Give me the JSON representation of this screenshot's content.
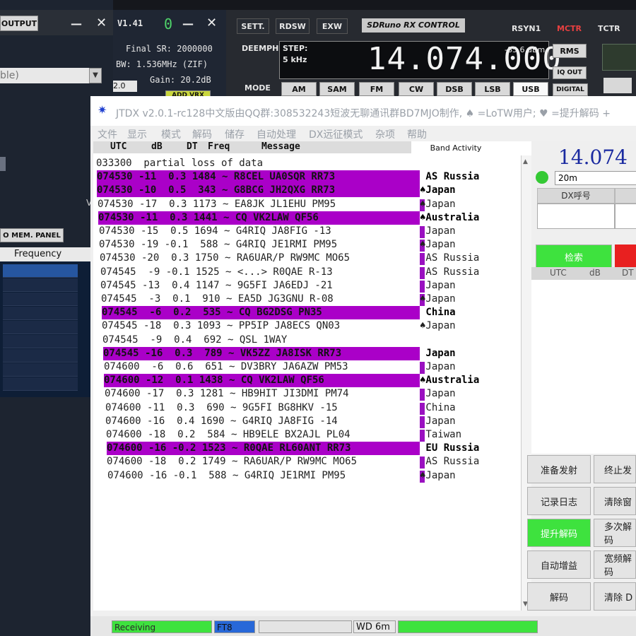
{
  "sdr_left": {
    "output_btn": "OUTPUT",
    "dropdown_value": "ble)",
    "mem_panel_btn": "O MEM. PANEL",
    "frequency_header": "Frequency",
    "stray_v": "V"
  },
  "sdr_mid": {
    "version": "V1.41",
    "digit": "0",
    "final_sr": "Final SR: 2000000",
    "bw": "BW: 1.536MHz (ZIF)",
    "gain": "Gain: 20.2dB",
    "zoom": "2.0",
    "add_vrx": "ADD VRX"
  },
  "rx_control": {
    "sett": "SETT.",
    "rdsw": "RDSW",
    "exw": "EXW",
    "title": "SDRuno RX CONTROL",
    "rsyn1": "RSYN1",
    "mctr": "MCTR",
    "tctr": "TCTR",
    "deemph": "DEEMPH",
    "step_label": "STEP:",
    "step_value": "5 kHz",
    "frequency": "14.074.000",
    "signal_dbm": "-85.6 dBm",
    "rms": "RMS",
    "iq_out": "IQ OUT",
    "digital": "DIGITAL",
    "mode_label": "MODE",
    "modes": [
      "AM",
      "SAM",
      "FM",
      "CW",
      "DSB",
      "LSB",
      "USB"
    ]
  },
  "jtdx": {
    "title": "JTDX   v2.0.1-rc128中文版由QQ群:308532243短波无聊通讯群BD7MJO制作, ♠ =LoTW用户; ♥ =提升解码 +",
    "menu": [
      "文件",
      "显示",
      "模式",
      "解码",
      "储存",
      "自动处理",
      "DX远征模式",
      "杂项",
      "帮助"
    ],
    "header": {
      "utc": "UTC",
      "db": "dB",
      "dt": "DT",
      "freq": "Freq",
      "message": "Message",
      "band_activity": "Band Activity"
    },
    "rows": [
      {
        "text": "033300  partial loss of data",
        "act": "",
        "hl": false
      },
      {
        "text": "074530 -11  0.3 1484 ~ R8CEL UA0SQR RR73",
        "act": " AS Russia",
        "hl": true
      },
      {
        "text": "074530 -10  0.5  343 ~ G8BCG JH2QXG RR73",
        "act": "♠Japan",
        "hl": true
      },
      {
        "text": "074530 -17  0.3 1173 ~ EA8JK JL1EHU PM95",
        "act": "♠Japan",
        "hl": false,
        "mk": true
      },
      {
        "text": "074530 -11  0.3 1441 ~ CQ VK2LAW QF56",
        "act": "♠Australia",
        "hl": true
      },
      {
        "text": "074530 -15  0.5 1694 ~ G4RIQ JA8FIG -13",
        "act": " Japan",
        "hl": false,
        "mk": true
      },
      {
        "text": "074530 -19 -0.1  588 ~ G4RIQ JE1RMI PM95",
        "act": "♠Japan",
        "hl": false,
        "mk": true
      },
      {
        "text": "074530 -20  0.3 1750 ~ RA6UAR/P RW9MC MO65",
        "act": " AS Russia",
        "hl": false,
        "mk": true
      },
      {
        "text": "074545  -9 -0.1 1525 ~ <...> R0QAE R-13",
        "act": " AS Russia",
        "hl": false,
        "mk": true
      },
      {
        "text": "074545 -13  0.4 1147 ~ 9G5FI JA6EDJ -21",
        "act": " Japan",
        "hl": false,
        "mk": true
      },
      {
        "text": "074545  -3  0.1  910 ~ EA5D JG3GNU R-08",
        "act": "♠Japan",
        "hl": false,
        "mk": true
      },
      {
        "text": "074545  -6  0.2  535 ~ CQ BG2DSG PN35",
        "act": " China",
        "hl": true
      },
      {
        "text": "074545 -18  0.3 1093 ~ PP5IP JA8ECS QN03",
        "act": "♠Japan",
        "hl": false
      },
      {
        "text": "074545  -9  0.4  692 ~ QSL 1WAY",
        "act": "",
        "hl": false
      },
      {
        "text": "074545 -16  0.3  789 ~ VK5ZZ JA8ISK RR73",
        "act": " Japan",
        "hl": true
      },
      {
        "text": "074600  -6  0.6  651 ~ DV3BRY JA6AZW PM53",
        "act": " Japan",
        "hl": false,
        "mk": true
      },
      {
        "text": "074600 -12  0.1 1438 ~ CQ VK2LAW QF56",
        "act": "♠Australia",
        "hl": true
      },
      {
        "text": "074600 -17  0.3 1281 ~ HB9HIT JI3DMI PM74",
        "act": " Japan",
        "hl": false,
        "mk": true
      },
      {
        "text": "074600 -11  0.3  690 ~ 9G5FI BG8HKV -15",
        "act": " China",
        "hl": false,
        "mk": true
      },
      {
        "text": "074600 -16  0.4 1690 ~ G4RIQ JA8FIG -14",
        "act": " Japan",
        "hl": false,
        "mk": true
      },
      {
        "text": "074600 -18  0.2  584 ~ HB9ELE BX2AJL PL04",
        "act": " Taiwan",
        "hl": false,
        "mk": true
      },
      {
        "text": "074600 -16 -0.2 1523 ~ R0QAE RL60ANT RR73",
        "act": " EU Russia",
        "hl": true
      },
      {
        "text": "074600 -18  0.2 1749 ~ RA6UAR/P RW9MC MO65",
        "act": " AS Russia",
        "hl": false,
        "mk": true
      },
      {
        "text": "074600 -16 -0.1  588 ~ G4RIQ JE1RMI PM95",
        "act": "♠Japan",
        "hl": false,
        "mk": true
      }
    ],
    "right": {
      "frequency": "14.074",
      "band": "20m",
      "dx_call_label": "DX呼号",
      "search_btn": "检索",
      "list_header": {
        "utc": "UTC",
        "db": "dB",
        "dt": "DT"
      },
      "buttons": [
        [
          "准备发射",
          "终止发"
        ],
        [
          "记录日志",
          "清除窗"
        ],
        [
          "提升解码",
          "多次解码"
        ],
        [
          "自动增益",
          "宽频解码"
        ],
        [
          "解码",
          "清除 D"
        ]
      ]
    },
    "status": {
      "state": "Receiving",
      "mode": "FT8",
      "wd": "WD 6m"
    }
  },
  "colors": {
    "highlight": "#aa00c8",
    "marker": "#9a10c0",
    "green": "#34e034",
    "freq_blue": "#1a2aa0",
    "red": "#e82020"
  }
}
